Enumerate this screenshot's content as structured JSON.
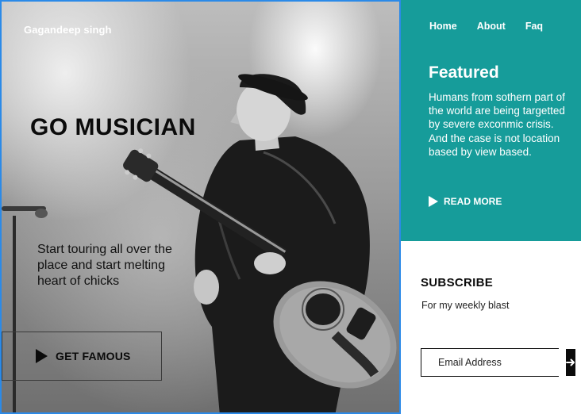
{
  "brand": "Gagandeep singh",
  "hero": {
    "headline": "GO MUSICIAN",
    "tagline": "Start touring all over the place and start melting heart of chicks",
    "cta_label": "GET FAMOUS"
  },
  "nav": {
    "items": [
      "Home",
      "About",
      "Faq"
    ]
  },
  "featured": {
    "title": "Featured",
    "body": "Humans from sothern part of the world are being targetted by severe exconmic crisis. And the case is not location based by view based.",
    "read_more": "READ MORE"
  },
  "subscribe": {
    "title": "SUBSCRIBE",
    "text": "For my weekly blast",
    "placeholder": "Email Address",
    "submit_icon": "arrow-right-icon"
  },
  "colors": {
    "accent": "#169c9a",
    "dark": "#0b0b0b",
    "selection_border": "#2b8ae8"
  }
}
